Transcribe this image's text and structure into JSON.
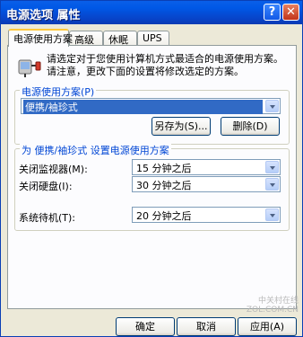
{
  "window": {
    "title": "电源选项 属性",
    "help_glyph": "?",
    "close_glyph": "✕"
  },
  "tabs": [
    {
      "label": "电源使用方案",
      "active": true
    },
    {
      "label": "高级",
      "active": false
    },
    {
      "label": "休眠",
      "active": false
    },
    {
      "label": "UPS",
      "active": false
    }
  ],
  "description": "请选定对于您使用计算机方式最适合的电源使用方案。请注意，更改下面的设置将修改选定的方案。",
  "scheme": {
    "label": "电源使用方案(P)",
    "selected": "便携/袖珍式",
    "save_as_label": "另存为(S)...",
    "delete_label": "删除(D)"
  },
  "settings": {
    "group_title": "为 便携/袖珍式 设置电源使用方案",
    "monitor_label": "关闭监视器(M):",
    "monitor_value": "15 分钟之后",
    "hdd_label": "关闭硬盘(I):",
    "hdd_value": "30 分钟之后",
    "standby_label": "系统待机(T):",
    "standby_value": "20 分钟之后"
  },
  "buttons": {
    "ok": "确定",
    "cancel": "取消",
    "apply": "应用(A)"
  },
  "watermark": {
    "line1": "中关村在线",
    "line2": "ZOL.COM.CN"
  },
  "colors": {
    "titlebar": "#0a5fe8",
    "selection": "#316ac5",
    "group_title": "#0046d5",
    "tab_highlight": "#ffc83c"
  }
}
